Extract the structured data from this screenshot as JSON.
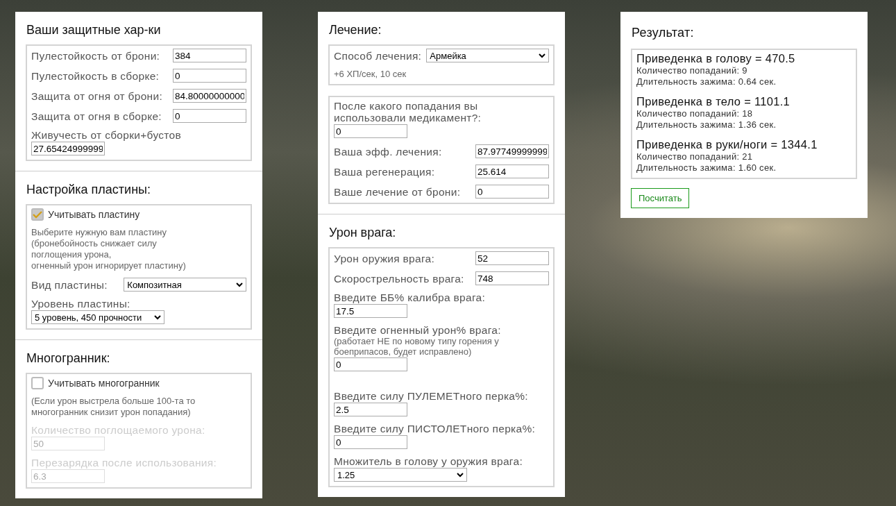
{
  "columns": [
    {
      "sections": [
        {
          "title": "Ваши защитные хар-ки",
          "groups": [
            {
              "fields": [
                {
                  "kind": "inline",
                  "label": "Пулестойкость от брони:",
                  "value": "384",
                  "disabled": false
                },
                {
                  "kind": "inline",
                  "label": "Пулестойкость в сборке:",
                  "value": "0",
                  "disabled": false
                },
                {
                  "kind": "inline",
                  "label": "Защита от огня от брони:",
                  "value": "84.80000000000",
                  "disabled": false
                },
                {
                  "kind": "inline",
                  "label": "Защита от огня в сборке:",
                  "value": "0",
                  "disabled": false
                },
                {
                  "kind": "stacked",
                  "label": "Живучесть от сборки+бустов",
                  "value": "27.65424999999",
                  "disabled": false
                }
              ]
            }
          ]
        },
        {
          "title": "Настройка пластины:",
          "groups": [
            {
              "fields": [
                {
                  "kind": "checkbox",
                  "label": "Учитывать пластину",
                  "checked": true
                },
                {
                  "kind": "note",
                  "text": "Выберите нужную вам пластину\n(бронебойность снижает силу\nпоглощения урона,\nогненный урон игнорирует пластину)"
                },
                {
                  "kind": "select-inline",
                  "label": "Вид пластины:",
                  "value": "Композитная",
                  "disabled": false
                },
                {
                  "kind": "select-stacked",
                  "label": "Уровень пластины:",
                  "value": "5 уровень, 450 прочности",
                  "disabled": false
                }
              ]
            }
          ]
        },
        {
          "title": "Многогранник:",
          "groups": [
            {
              "fields": [
                {
                  "kind": "checkbox",
                  "label": "Учитывать многогранник",
                  "checked": false
                },
                {
                  "kind": "note",
                  "text": "(Если урон выстрела больше 100-та то\nмногогранник снизит урон попадания)",
                  "disabled": true
                },
                {
                  "kind": "stacked",
                  "label": "Количество поглощаемого урона:",
                  "value": "50",
                  "disabled": true
                },
                {
                  "kind": "stacked",
                  "label": "Перезарядка после использования:",
                  "value": "6.3",
                  "disabled": true
                }
              ]
            }
          ]
        }
      ]
    },
    {
      "sections": [
        {
          "title": "Лечение:",
          "groups": [
            {
              "fields": [
                {
                  "kind": "select-inline",
                  "label": "Способ лечения:",
                  "value": "Армейка",
                  "disabled": false
                },
                {
                  "kind": "note",
                  "text": "+6 ХП/сек, 10 сек"
                }
              ]
            },
            {
              "fields": [
                {
                  "kind": "stacked",
                  "label": "После какого попадания вы использовали медикамент?:",
                  "value": "0",
                  "disabled": false
                },
                {
                  "kind": "inline",
                  "label": "Ваша эфф. лечения:",
                  "value": "87.97749999999",
                  "disabled": false
                },
                {
                  "kind": "inline",
                  "label": "Ваша регенерация:",
                  "value": "25.614",
                  "disabled": false
                },
                {
                  "kind": "inline",
                  "label": "Ваше лечение от брони:",
                  "value": "0",
                  "disabled": false
                }
              ]
            }
          ]
        },
        {
          "title": "Урон врага:",
          "groups": [
            {
              "fields": [
                {
                  "kind": "inline",
                  "label": "Урон оружия врага:",
                  "value": "52",
                  "disabled": false
                },
                {
                  "kind": "inline",
                  "label": "Скорострельность врага:",
                  "value": "748",
                  "disabled": false
                },
                {
                  "kind": "stacked",
                  "label": "Введите ББ% калибра врага:",
                  "value": "17.5",
                  "disabled": false
                },
                {
                  "kind": "stacked",
                  "label": "Введите огненный урон% врага:",
                  "note": "(работает НЕ по новому типу горения у боеприпасов, будет исправлено)",
                  "value": "0",
                  "disabled": false
                },
                {
                  "kind": "stacked",
                  "label": "Введите силу ПУЛЕМЕТного перка%:",
                  "value": "2.5",
                  "disabled": false
                },
                {
                  "kind": "stacked",
                  "label": "Введите силу ПИСТОЛЕТного перка%:",
                  "value": "0",
                  "disabled": false
                },
                {
                  "kind": "select-stacked",
                  "label": "Множитель в голову у оружия врага:",
                  "value": "1.25",
                  "disabled": false
                }
              ]
            }
          ]
        }
      ]
    }
  ],
  "result": {
    "title": "Результат:",
    "items": [
      {
        "heading": "Приведенка в голову = 470.5",
        "lines": [
          "Количество попаданий: 9",
          "Длительность зажима: 0.64 сек."
        ]
      },
      {
        "heading": "Приведенка в тело = 1101.1",
        "lines": [
          "Количество попаданий: 18",
          "Длительность зажима: 1.36 сек."
        ]
      },
      {
        "heading": "Приведенка в руки/ноги = 1344.1",
        "lines": [
          "Количество попаданий: 21",
          "Длительность зажима: 1.60 сек."
        ]
      }
    ],
    "button": "Посчитать"
  }
}
